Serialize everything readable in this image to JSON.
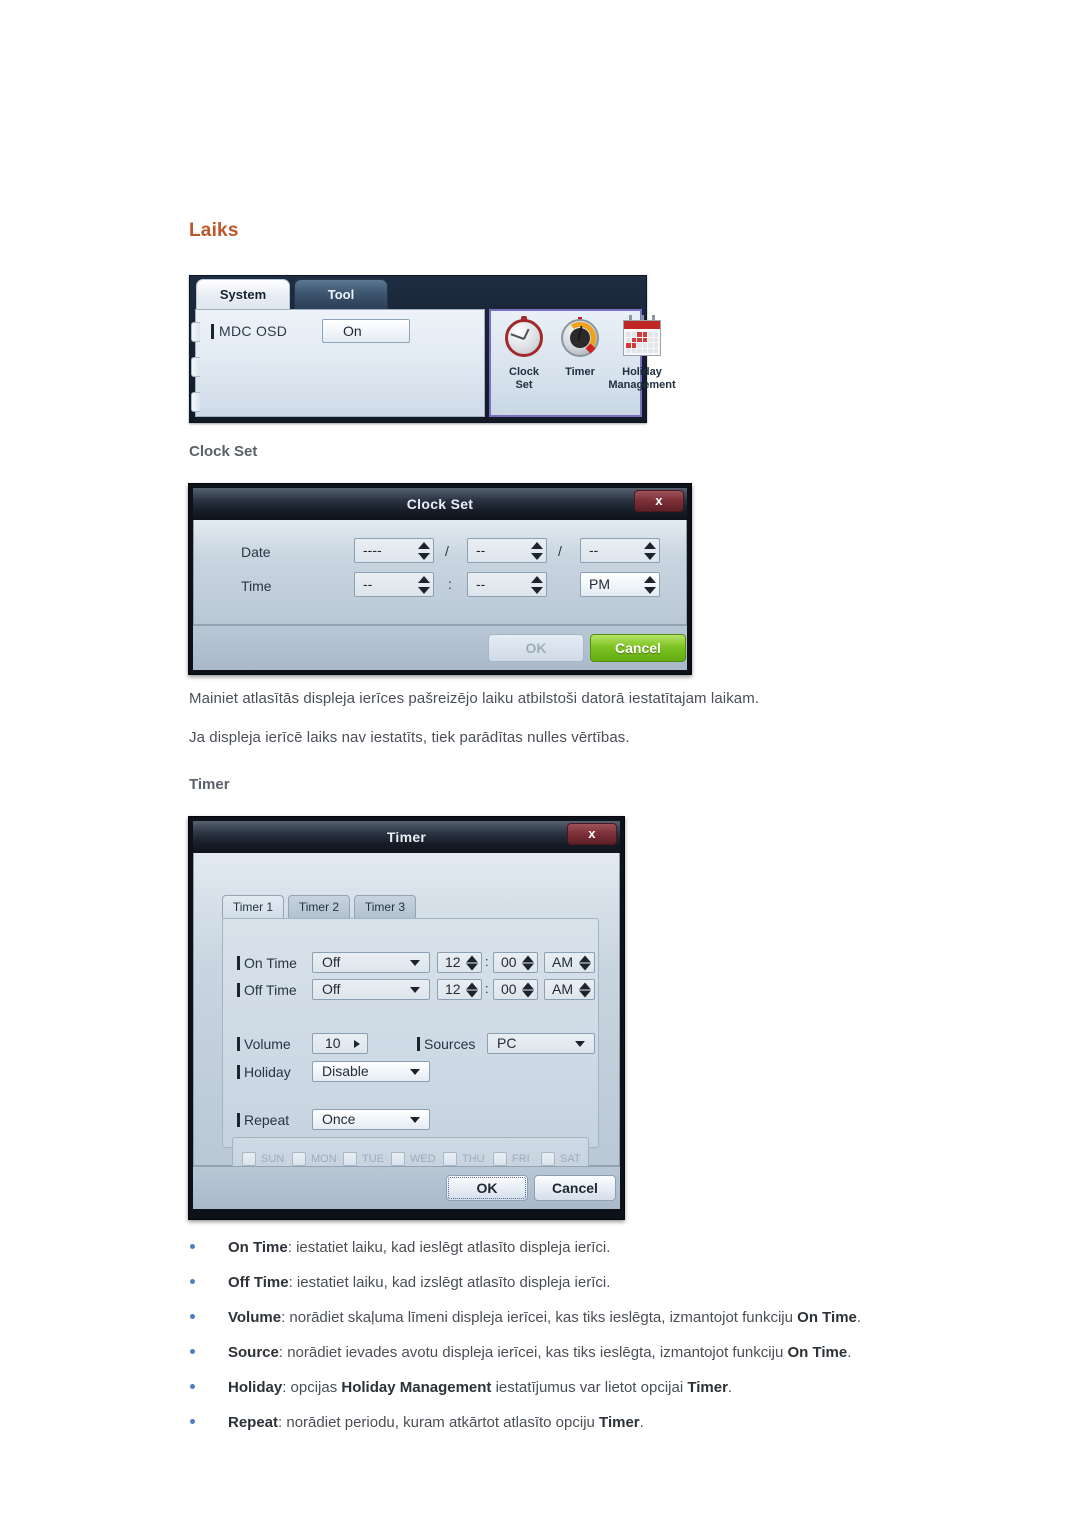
{
  "heading": "Laiks",
  "accent_color": "#c0572a",
  "mdc_panel": {
    "tabs": [
      {
        "label": "System",
        "active": true
      },
      {
        "label": "Tool",
        "active": false
      }
    ],
    "osd": {
      "label": "MDC OSD",
      "value": "On"
    },
    "icons": [
      {
        "name": "clock-set-icon",
        "line1": "Clock",
        "line2": "Set"
      },
      {
        "name": "timer-icon",
        "line1": "Timer",
        "line2": ""
      },
      {
        "name": "holiday-management-icon",
        "line1": "Holiday",
        "line2": "Management"
      }
    ]
  },
  "clock_set_section": {
    "subheading": "Clock Set",
    "dialog": {
      "title": "Clock Set",
      "close_label": "x",
      "date_label": "Date",
      "time_label": "Time",
      "date_year": "----",
      "date_month": "--",
      "date_day": "--",
      "time_hour": "--",
      "time_minute": "--",
      "time_meridiem": "PM",
      "date_sep_1": "/",
      "date_sep_2": "/",
      "time_sep": ":",
      "ok_label": "OK",
      "cancel_label": "Cancel"
    },
    "paragraphs": [
      "Mainiet atlasītās displeja ierīces pašreizējo laiku atbilstoši datorā iestatītajam laikam.",
      "Ja displeja ierīcē laiks nav iestatīts, tiek parādītas nulles vērtības."
    ]
  },
  "timer_section": {
    "subheading": "Timer",
    "dialog": {
      "title": "Timer",
      "close_label": "x",
      "tabs": [
        {
          "label": "Timer 1",
          "active": true
        },
        {
          "label": "Timer 2",
          "active": false
        },
        {
          "label": "Timer 3",
          "active": false
        }
      ],
      "rows": {
        "on_time": {
          "label": "On Time",
          "mode": "Off",
          "hour": "12",
          "minute": "00",
          "meridiem": "AM",
          "sep": ":"
        },
        "off_time": {
          "label": "Off Time",
          "mode": "Off",
          "hour": "12",
          "minute": "00",
          "meridiem": "AM",
          "sep": ":"
        },
        "volume": {
          "label": "Volume",
          "value": "10"
        },
        "sources": {
          "label": "Sources",
          "value": "PC"
        },
        "holiday": {
          "label": "Holiday",
          "value": "Disable"
        },
        "repeat": {
          "label": "Repeat",
          "value": "Once"
        }
      },
      "days": [
        "SUN",
        "MON",
        "TUE",
        "WED",
        "THU",
        "FRI",
        "SAT"
      ],
      "ok_label": "OK",
      "cancel_label": "Cancel"
    }
  },
  "bullets": [
    {
      "term": "On Time",
      "rest_1": ": iestatiet laiku, kad ieslēgt atlasīto displeja ierīci.",
      "term_2": "",
      "rest_2": ""
    },
    {
      "term": "Off Time",
      "rest_1": ": iestatiet laiku, kad izslēgt atlasīto displeja ierīci.",
      "term_2": "",
      "rest_2": ""
    },
    {
      "term": "Volume",
      "rest_1": ": norādiet skaļuma līmeni displeja ierīcei, kas tiks ieslēgta, izmantojot funkciju ",
      "term_2": "On Time",
      "rest_2": "."
    },
    {
      "term": "Source",
      "rest_1": ": norādiet ievades avotu displeja ierīcei, kas tiks ieslēgta, izmantojot funkciju ",
      "term_2": "On Time",
      "rest_2": "."
    },
    {
      "term": "Holiday",
      "rest_1": ": opcijas ",
      "term_2": "Holiday Management",
      "rest_2": " iestatījumus var lietot opcijai ",
      "term_3": "Timer",
      "rest_3": "."
    },
    {
      "term": "Repeat",
      "rest_1": ": norādiet periodu, kuram atkārtot atlasīto opciju ",
      "term_2": "Timer",
      "rest_2": "."
    }
  ]
}
